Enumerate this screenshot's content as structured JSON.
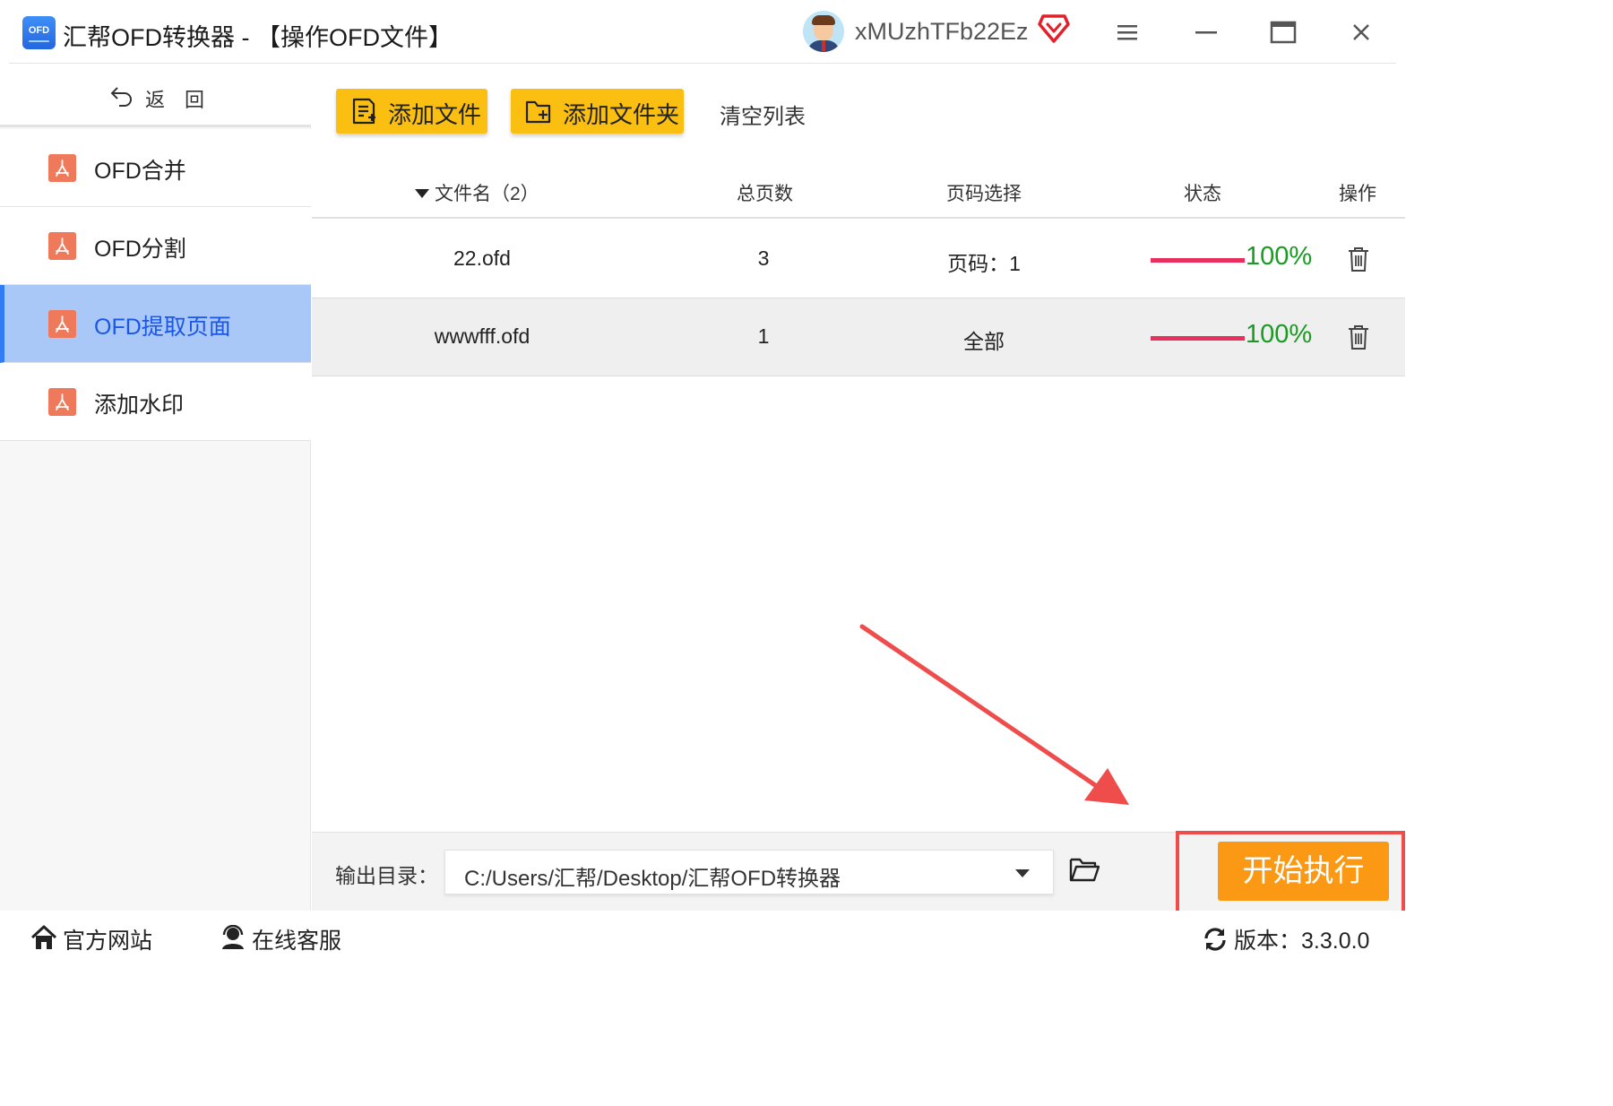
{
  "window": {
    "logo_text": "OFD",
    "title": "汇帮OFD转换器 - 【操作OFD文件】",
    "username": "xMUzhTFb22Ez",
    "icons": [
      "avatar",
      "vip-diamond-icon",
      "menu-icon",
      "minimize-icon",
      "maximize-icon",
      "close-icon"
    ]
  },
  "sidebar": {
    "back_label": "返回",
    "items": [
      {
        "label": "OFD合并",
        "active": false
      },
      {
        "label": "OFD分割",
        "active": false
      },
      {
        "label": "OFD提取页面",
        "active": true
      },
      {
        "label": "添加水印",
        "active": false
      }
    ]
  },
  "toolbar": {
    "add_file_label": "添加文件",
    "add_folder_label": "添加文件夹",
    "clear_list_label": "清空列表"
  },
  "table": {
    "headers": {
      "name": "文件名（2）",
      "pages": "总页数",
      "page_select": "页码选择",
      "status": "状态",
      "ops": "操作"
    },
    "rows": [
      {
        "name": "22.ofd",
        "pages": "3",
        "page_select": "页码：1",
        "progress": 100,
        "progress_text": "100%"
      },
      {
        "name": "wwwfff.ofd",
        "pages": "1",
        "page_select": "全部",
        "progress": 100,
        "progress_text": "100%"
      }
    ]
  },
  "output": {
    "label": "输出目录：",
    "path": "C:/Users/汇帮/Desktop/汇帮OFD转换器",
    "start_label": "开始执行"
  },
  "footer": {
    "site_label": "官方网站",
    "service_label": "在线客服",
    "version_label": "版本：3.3.0.0"
  },
  "colors": {
    "accent_blue": "#2f7cf6",
    "active_bg": "#a9c8f7",
    "button_yellow": "#fbbf12",
    "start_orange": "#fb9914",
    "progress_fill": "#e8305f",
    "progress_text": "#1b9a24",
    "annotation_red": "#ef4c4c"
  }
}
